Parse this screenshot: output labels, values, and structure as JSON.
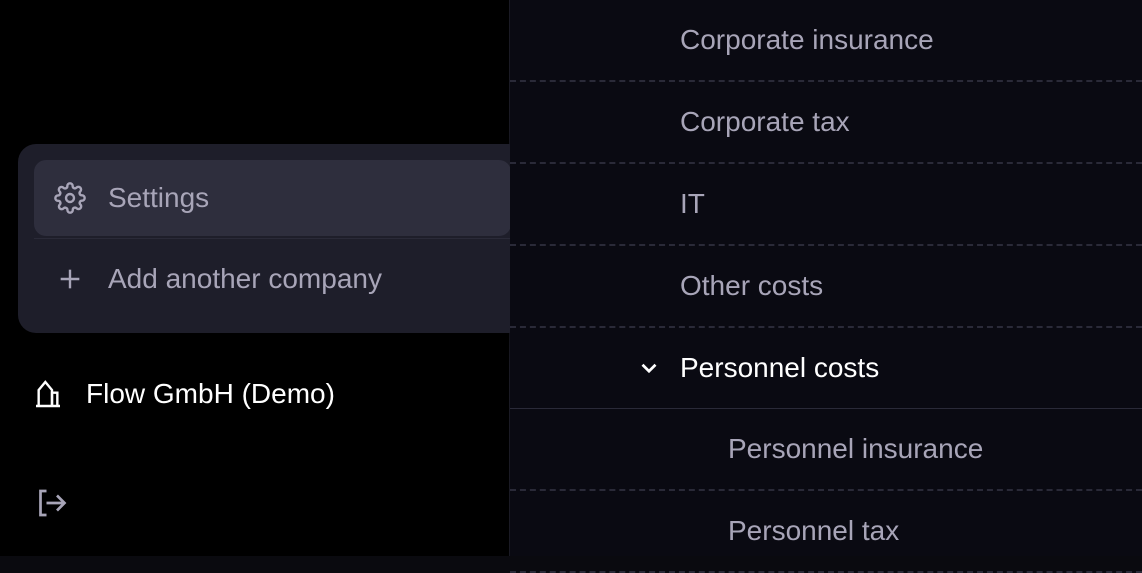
{
  "popup": {
    "settings_label": "Settings",
    "add_company_label": "Add another company"
  },
  "company": {
    "name": "Flow GmbH (Demo)"
  },
  "categories": [
    {
      "label": "Corporate insurance",
      "expanded": false,
      "child": false
    },
    {
      "label": "Corporate tax",
      "expanded": false,
      "child": false
    },
    {
      "label": "IT",
      "expanded": false,
      "child": false
    },
    {
      "label": "Other costs",
      "expanded": false,
      "child": false
    },
    {
      "label": "Personnel costs",
      "expanded": true,
      "child": false
    },
    {
      "label": "Personnel insurance",
      "expanded": false,
      "child": true
    },
    {
      "label": "Personnel tax",
      "expanded": false,
      "child": true
    }
  ],
  "colors": {
    "bg_dark": "#0a0a0f",
    "bg_popup": "#1e1e2a",
    "bg_active": "#2e2e3d",
    "text_muted": "#a8a5b8",
    "text_white": "#ffffff",
    "border": "#2a2a38"
  }
}
